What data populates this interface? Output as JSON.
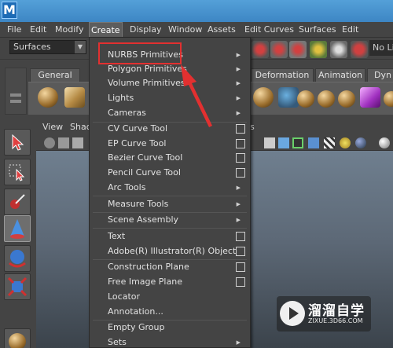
{
  "menubar": {
    "items": [
      "File",
      "Edit",
      "Modify",
      "Create",
      "Display",
      "Window",
      "Assets",
      "Edit Curves",
      "Surfaces",
      "Edit NURBS"
    ],
    "active": "Create"
  },
  "statusline": {
    "mode": "Surfaces",
    "no_live": "No Liv"
  },
  "shelf": {
    "tabs": [
      "General",
      "Deformation",
      "Animation",
      "Dyn"
    ]
  },
  "panel": {
    "menus": [
      "View",
      "Shad",
      "s"
    ]
  },
  "create_menu": {
    "items": [
      {
        "label": "NURBS Primitives",
        "type": "submenu"
      },
      {
        "label": "Polygon Primitives",
        "type": "submenu"
      },
      {
        "label": "Volume Primitives",
        "type": "submenu"
      },
      {
        "label": "Lights",
        "type": "submenu"
      },
      {
        "label": "Cameras",
        "type": "submenu"
      },
      {
        "label": "CV Curve Tool",
        "type": "option"
      },
      {
        "label": "EP Curve Tool",
        "type": "option"
      },
      {
        "label": "Bezier Curve Tool",
        "type": "option"
      },
      {
        "label": "Pencil Curve Tool",
        "type": "option"
      },
      {
        "label": "Arc Tools",
        "type": "submenu"
      },
      {
        "label": "Measure Tools",
        "type": "submenu"
      },
      {
        "label": "Scene Assembly",
        "type": "submenu"
      },
      {
        "label": "Text",
        "type": "option"
      },
      {
        "label": "Adobe(R) Illustrator(R) Object...",
        "type": "option"
      },
      {
        "label": "Construction Plane",
        "type": "option"
      },
      {
        "label": "Free Image Plane",
        "type": "option"
      },
      {
        "label": "Locator",
        "type": "plain"
      },
      {
        "label": "Annotation...",
        "type": "plain"
      },
      {
        "label": "Empty Group",
        "type": "plain"
      },
      {
        "label": "Sets",
        "type": "submenu"
      }
    ],
    "highlighted": "NURBS Primitives"
  },
  "watermark": {
    "title": "溜溜自学",
    "url": "ZIXUE.3D66.COM"
  },
  "colors": {
    "annotation": "#e23030",
    "menu_bg": "#444444",
    "titlebar": "#4a96d2"
  }
}
